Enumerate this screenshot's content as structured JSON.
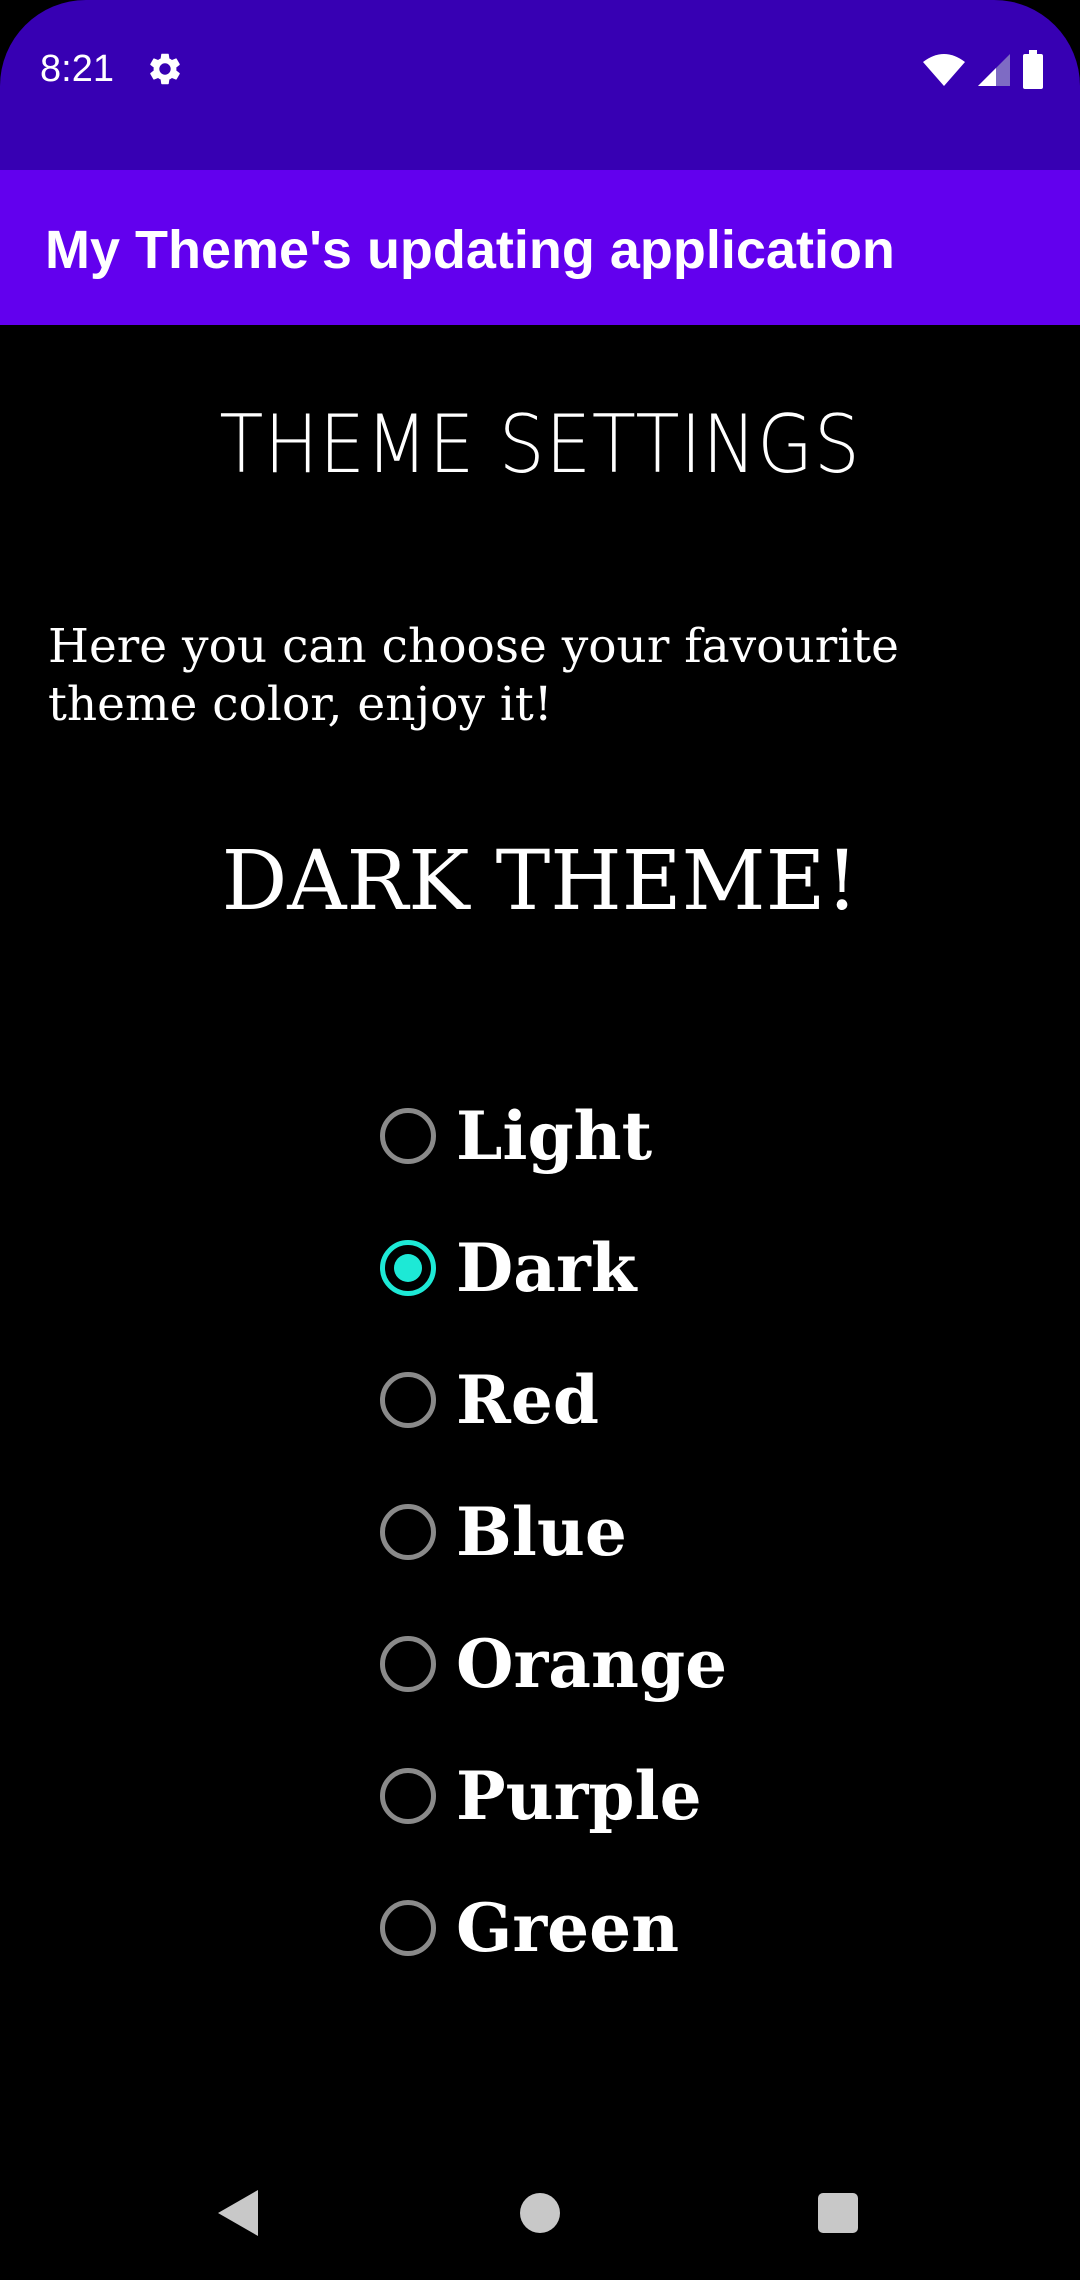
{
  "status_bar": {
    "time": "8:21",
    "icons": [
      "gear-icon",
      "wifi-icon",
      "signal-icon",
      "battery-icon"
    ]
  },
  "app_bar": {
    "title": "My Theme's updating application"
  },
  "content": {
    "title": "THEME SETTINGS",
    "intro": "Here you can choose your favourite theme color, enjoy it!",
    "current_theme": "DARK THEME!"
  },
  "theme_options": [
    {
      "label": "Light",
      "checked": false
    },
    {
      "label": "Dark",
      "checked": true
    },
    {
      "label": "Red",
      "checked": false
    },
    {
      "label": "Blue",
      "checked": false
    },
    {
      "label": "Orange",
      "checked": false
    },
    {
      "label": "Purple",
      "checked": false
    },
    {
      "label": "Green",
      "checked": false
    }
  ],
  "nav_bar": {
    "icons": [
      "back-icon",
      "home-icon",
      "recents-icon"
    ]
  },
  "colors": {
    "status_bar": "#3700B3",
    "app_bar": "#6200EE",
    "accent": "#1DE9D6",
    "background": "#000000",
    "text": "#FFFFFF"
  }
}
